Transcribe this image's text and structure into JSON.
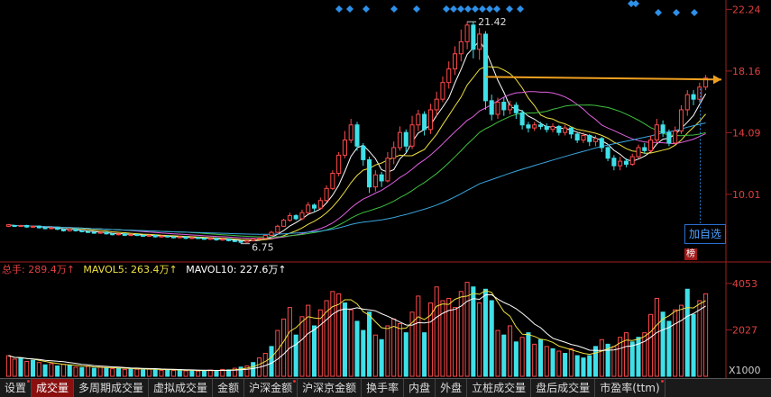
{
  "chart_data": [
    {
      "type": "candlestick",
      "price_axis": {
        "ticks": [
          22.24,
          18.16,
          14.09,
          10.01
        ],
        "ylim": [
          5.6,
          22.5
        ]
      },
      "annotations": {
        "high_label": "21.42",
        "low_label": "6.75",
        "resistance_price": 17.6
      },
      "candles": [
        [
          7.9,
          8.0,
          7.85,
          8.05
        ],
        [
          7.95,
          7.9,
          7.85,
          8.0
        ],
        [
          7.9,
          7.95,
          7.85,
          8.0
        ],
        [
          7.95,
          7.85,
          7.8,
          8.0
        ],
        [
          7.85,
          7.9,
          7.8,
          7.95
        ],
        [
          7.9,
          7.8,
          7.75,
          7.95
        ],
        [
          7.8,
          7.75,
          7.7,
          7.85
        ],
        [
          7.75,
          7.8,
          7.7,
          7.85
        ],
        [
          7.8,
          7.7,
          7.65,
          7.85
        ],
        [
          7.7,
          7.6,
          7.55,
          7.75
        ],
        [
          7.6,
          7.7,
          7.55,
          7.75
        ],
        [
          7.7,
          7.6,
          7.55,
          7.72
        ],
        [
          7.6,
          7.55,
          7.5,
          7.65
        ],
        [
          7.55,
          7.5,
          7.45,
          7.6
        ],
        [
          7.5,
          7.45,
          7.4,
          7.55
        ],
        [
          7.45,
          7.5,
          7.4,
          7.55
        ],
        [
          7.5,
          7.4,
          7.35,
          7.55
        ],
        [
          7.4,
          7.35,
          7.3,
          7.45
        ],
        [
          7.35,
          7.4,
          7.3,
          7.45
        ],
        [
          7.4,
          7.3,
          7.25,
          7.45
        ],
        [
          7.3,
          7.35,
          7.25,
          7.4
        ],
        [
          7.35,
          7.3,
          7.25,
          7.4
        ],
        [
          7.3,
          7.25,
          7.2,
          7.35
        ],
        [
          7.25,
          7.3,
          7.2,
          7.35
        ],
        [
          7.3,
          7.2,
          7.15,
          7.35
        ],
        [
          7.2,
          7.25,
          7.15,
          7.3
        ],
        [
          7.25,
          7.2,
          7.15,
          7.3
        ],
        [
          7.2,
          7.15,
          7.1,
          7.25
        ],
        [
          7.15,
          7.2,
          7.1,
          7.25
        ],
        [
          7.2,
          7.1,
          7.05,
          7.25
        ],
        [
          7.1,
          7.15,
          7.05,
          7.2
        ],
        [
          7.15,
          7.1,
          7.05,
          7.2
        ],
        [
          7.1,
          7.05,
          7.0,
          7.15
        ],
        [
          7.05,
          7.1,
          7.0,
          7.15
        ],
        [
          7.1,
          7.0,
          6.95,
          7.15
        ],
        [
          7.0,
          7.05,
          6.95,
          7.1
        ],
        [
          7.05,
          6.95,
          6.9,
          7.1
        ],
        [
          6.95,
          6.9,
          6.85,
          7.0
        ],
        [
          6.9,
          6.85,
          6.75,
          6.95
        ],
        [
          6.85,
          6.95,
          6.8,
          7.0
        ],
        [
          6.95,
          7.05,
          6.9,
          7.1
        ],
        [
          7.05,
          7.1,
          7.0,
          7.15
        ],
        [
          7.1,
          7.3,
          7.05,
          7.35
        ],
        [
          7.3,
          7.5,
          7.25,
          7.6
        ],
        [
          7.5,
          7.9,
          7.45,
          8.0
        ],
        [
          7.9,
          8.3,
          7.85,
          8.4
        ],
        [
          8.3,
          8.6,
          8.2,
          8.8
        ],
        [
          8.6,
          8.4,
          8.3,
          8.7
        ],
        [
          8.4,
          8.8,
          8.3,
          9.0
        ],
        [
          8.8,
          9.3,
          8.7,
          9.5
        ],
        [
          9.3,
          9.1,
          8.9,
          9.4
        ],
        [
          9.1,
          9.6,
          9.0,
          9.8
        ],
        [
          9.6,
          10.4,
          9.5,
          10.6
        ],
        [
          10.4,
          11.4,
          10.3,
          11.6
        ],
        [
          11.4,
          12.6,
          11.2,
          12.8
        ],
        [
          12.6,
          13.6,
          12.4,
          14.2
        ],
        [
          13.6,
          14.6,
          13.4,
          15.0
        ],
        [
          14.6,
          13.2,
          12.9,
          14.8
        ],
        [
          13.2,
          12.3,
          11.9,
          13.4
        ],
        [
          12.3,
          10.5,
          10.1,
          12.5
        ],
        [
          10.5,
          11.3,
          10.2,
          11.6
        ],
        [
          11.3,
          10.9,
          10.5,
          11.5
        ],
        [
          10.9,
          12.4,
          10.8,
          12.8
        ],
        [
          12.4,
          13.1,
          12.0,
          13.5
        ],
        [
          13.1,
          14.1,
          12.9,
          14.5
        ],
        [
          14.1,
          13.2,
          12.8,
          14.3
        ],
        [
          13.2,
          14.6,
          13.0,
          15.2
        ],
        [
          14.6,
          15.3,
          14.2,
          15.6
        ],
        [
          15.3,
          14.3,
          13.9,
          15.5
        ],
        [
          14.3,
          15.6,
          14.0,
          16.0
        ],
        [
          15.6,
          16.3,
          15.2,
          16.8
        ],
        [
          16.3,
          17.4,
          16.1,
          17.8
        ],
        [
          17.4,
          18.3,
          17.0,
          18.8
        ],
        [
          18.3,
          19.3,
          17.9,
          19.8
        ],
        [
          19.3,
          20.1,
          18.8,
          20.9
        ],
        [
          20.1,
          21.2,
          19.6,
          21.42
        ],
        [
          21.2,
          19.6,
          19.0,
          21.4
        ],
        [
          19.6,
          20.6,
          18.9,
          21.0
        ],
        [
          20.6,
          16.2,
          15.6,
          20.8
        ],
        [
          16.2,
          15.3,
          14.9,
          16.6
        ],
        [
          15.3,
          16.1,
          15.0,
          16.4
        ],
        [
          16.1,
          15.6,
          15.2,
          16.4
        ],
        [
          15.6,
          15.9,
          15.3,
          16.2
        ],
        [
          15.9,
          15.4,
          15.0,
          16.1
        ],
        [
          15.4,
          14.6,
          14.3,
          15.6
        ],
        [
          14.6,
          14.4,
          14.1,
          14.8
        ],
        [
          14.4,
          14.6,
          14.2,
          14.8
        ],
        [
          14.6,
          14.5,
          14.3,
          14.8
        ],
        [
          14.5,
          14.3,
          14.1,
          14.7
        ],
        [
          14.3,
          14.5,
          14.1,
          14.7
        ],
        [
          14.5,
          14.1,
          13.9,
          14.6
        ],
        [
          14.1,
          14.4,
          13.9,
          14.6
        ],
        [
          14.4,
          14.0,
          13.7,
          14.5
        ],
        [
          14.0,
          13.6,
          13.4,
          14.1
        ],
        [
          13.6,
          13.9,
          13.4,
          14.1
        ],
        [
          13.9,
          13.5,
          13.2,
          14.0
        ],
        [
          13.5,
          13.7,
          13.2,
          13.9
        ],
        [
          13.7,
          13.1,
          12.8,
          13.8
        ],
        [
          13.1,
          12.4,
          12.2,
          13.2
        ],
        [
          12.4,
          11.9,
          11.6,
          12.6
        ],
        [
          11.9,
          12.2,
          11.6,
          12.5
        ],
        [
          12.2,
          12.0,
          11.8,
          12.4
        ],
        [
          12.0,
          12.5,
          11.9,
          12.7
        ],
        [
          12.5,
          13.1,
          12.4,
          13.3
        ],
        [
          13.1,
          12.9,
          12.7,
          13.4
        ],
        [
          12.9,
          13.6,
          12.8,
          13.9
        ],
        [
          13.6,
          14.6,
          13.4,
          15.0
        ],
        [
          14.6,
          14.1,
          13.8,
          14.9
        ],
        [
          14.1,
          13.4,
          13.2,
          14.3
        ],
        [
          13.4,
          14.2,
          13.3,
          14.5
        ],
        [
          14.2,
          15.6,
          14.0,
          15.9
        ],
        [
          15.6,
          16.6,
          15.2,
          16.9
        ],
        [
          16.6,
          16.3,
          15.9,
          16.9
        ],
        [
          16.3,
          17.1,
          16.1,
          17.4
        ],
        [
          17.1,
          17.7,
          16.9,
          17.9
        ]
      ]
    },
    {
      "type": "bar",
      "volume_axis": {
        "ticks": [
          4053,
          2027
        ],
        "unit": "X1000",
        "ylim": [
          0,
          4400
        ]
      },
      "volumes": [
        [
          900,
          0
        ],
        [
          750,
          0
        ],
        [
          800,
          1
        ],
        [
          650,
          0
        ],
        [
          700,
          1
        ],
        [
          600,
          0
        ],
        [
          500,
          1
        ],
        [
          550,
          0
        ],
        [
          450,
          1
        ],
        [
          520,
          0
        ],
        [
          480,
          1
        ],
        [
          400,
          0
        ],
        [
          380,
          1
        ],
        [
          430,
          0
        ],
        [
          350,
          1
        ],
        [
          400,
          0
        ],
        [
          370,
          1
        ],
        [
          330,
          0
        ],
        [
          360,
          1
        ],
        [
          300,
          0
        ],
        [
          340,
          1
        ],
        [
          310,
          0
        ],
        [
          280,
          1
        ],
        [
          330,
          0
        ],
        [
          300,
          1
        ],
        [
          260,
          0
        ],
        [
          290,
          1
        ],
        [
          250,
          0
        ],
        [
          270,
          1
        ],
        [
          240,
          0
        ],
        [
          260,
          1
        ],
        [
          230,
          0
        ],
        [
          250,
          1
        ],
        [
          270,
          0
        ],
        [
          240,
          1
        ],
        [
          300,
          0
        ],
        [
          280,
          1
        ],
        [
          350,
          0
        ],
        [
          400,
          1
        ],
        [
          450,
          0
        ],
        [
          600,
          1
        ],
        [
          800,
          0
        ],
        [
          1000,
          0
        ],
        [
          1300,
          1
        ],
        [
          2000,
          0
        ],
        [
          2500,
          0
        ],
        [
          3000,
          0
        ],
        [
          1800,
          1
        ],
        [
          2600,
          0
        ],
        [
          3100,
          0
        ],
        [
          2200,
          1
        ],
        [
          2900,
          0
        ],
        [
          3300,
          0
        ],
        [
          3700,
          0
        ],
        [
          3600,
          0
        ],
        [
          3200,
          1
        ],
        [
          2900,
          0
        ],
        [
          2400,
          1
        ],
        [
          2000,
          1
        ],
        [
          2800,
          1
        ],
        [
          1800,
          0
        ],
        [
          1600,
          1
        ],
        [
          2200,
          0
        ],
        [
          2500,
          0
        ],
        [
          2300,
          0
        ],
        [
          1900,
          1
        ],
        [
          2800,
          0
        ],
        [
          3500,
          0
        ],
        [
          1900,
          1
        ],
        [
          3200,
          0
        ],
        [
          3900,
          0
        ],
        [
          3300,
          0
        ],
        [
          3400,
          0
        ],
        [
          3000,
          0
        ],
        [
          3700,
          0
        ],
        [
          4100,
          0
        ],
        [
          3900,
          1
        ],
        [
          3200,
          0
        ],
        [
          3800,
          1
        ],
        [
          3300,
          1
        ],
        [
          2000,
          0
        ],
        [
          1800,
          1
        ],
        [
          2200,
          0
        ],
        [
          1500,
          1
        ],
        [
          1700,
          0
        ],
        [
          1900,
          1
        ],
        [
          1400,
          0
        ],
        [
          1600,
          1
        ],
        [
          1300,
          0
        ],
        [
          1200,
          1
        ],
        [
          1100,
          0
        ],
        [
          1000,
          1
        ],
        [
          1200,
          0
        ],
        [
          900,
          1
        ],
        [
          800,
          1
        ],
        [
          900,
          1
        ],
        [
          1300,
          1
        ],
        [
          1600,
          0
        ],
        [
          1400,
          1
        ],
        [
          1300,
          0
        ],
        [
          1700,
          0
        ],
        [
          1900,
          0
        ],
        [
          1500,
          1
        ],
        [
          1700,
          1
        ],
        [
          1900,
          0
        ],
        [
          2700,
          0
        ],
        [
          3400,
          0
        ],
        [
          2800,
          1
        ],
        [
          2400,
          1
        ],
        [
          2900,
          0
        ],
        [
          3100,
          0
        ],
        [
          3800,
          1
        ],
        [
          2700,
          1
        ],
        [
          3300,
          0
        ],
        [
          3600,
          0
        ]
      ]
    }
  ],
  "volume_header": {
    "total_label": "总手: 289.4万↑",
    "mavol5_label": "MAVOL5: 263.4万↑",
    "mavol10_label": "MAVOL10: 227.6万↑"
  },
  "add_watchlist_label": "加自选",
  "rank_tag": "榜",
  "tabs": [
    {
      "label": "设置",
      "active": false,
      "dot": true
    },
    {
      "label": "成交量",
      "active": true,
      "dot": false
    },
    {
      "label": "多周期成交量",
      "active": false,
      "dot": false
    },
    {
      "label": "虚拟成交量",
      "active": false,
      "dot": false
    },
    {
      "label": "金额",
      "active": false,
      "dot": false
    },
    {
      "label": "沪深金额",
      "active": false,
      "dot": true
    },
    {
      "label": "沪深京金额",
      "active": false,
      "dot": false
    },
    {
      "label": "换手率",
      "active": false,
      "dot": false
    },
    {
      "label": "内盘",
      "active": false,
      "dot": false
    },
    {
      "label": "外盘",
      "active": false,
      "dot": false
    },
    {
      "label": "立桩成交量",
      "active": false,
      "dot": false
    },
    {
      "label": "盘后成交量",
      "active": false,
      "dot": false
    },
    {
      "label": "市盈率(ttm)",
      "active": false,
      "dot": true
    }
  ],
  "colors": {
    "up": "#ff4a4a",
    "down": "#3fe0e8",
    "ma5": "#ffffff",
    "ma10": "#f0e040",
    "ma20": "#e060e0",
    "ma30": "#40c040",
    "ma60": "#3aa6e0",
    "resistance": "#f0a020",
    "marker": "#2e90e8"
  }
}
